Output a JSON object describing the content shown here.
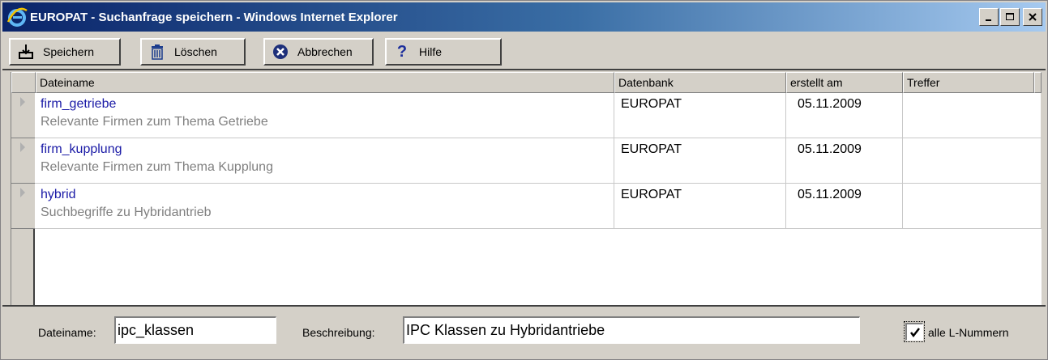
{
  "window": {
    "title": "EUROPAT - Suchanfrage speichern - Windows Internet Explorer",
    "controls": [
      "minimize",
      "maximize",
      "close"
    ]
  },
  "toolbar": {
    "save_label": "Speichern",
    "delete_label": "Löschen",
    "cancel_label": "Abbrechen",
    "help_label": "Hilfe",
    "icons": [
      "save-icon",
      "trash-icon",
      "cancel-icon",
      "help-icon"
    ]
  },
  "table": {
    "headers": [
      "Dateiname",
      "Datenbank",
      "erstellt am",
      "Treffer"
    ],
    "rows": [
      {
        "name": "firm_getriebe",
        "description": "Relevante Firmen zum Thema Getriebe",
        "database": "EUROPAT",
        "date": "05.11.2009",
        "hits": ""
      },
      {
        "name": "firm_kupplung",
        "description": "Relevante Firmen zum Thema Kupplung",
        "database": "EUROPAT",
        "date": "05.11.2009",
        "hits": ""
      },
      {
        "name": "hybrid",
        "description": "Suchbegriffe zu Hybridantrieb",
        "database": "EUROPAT",
        "date": "05.11.2009",
        "hits": ""
      }
    ]
  },
  "form": {
    "filename_label": "Dateiname:",
    "filename_value": "ipc_klassen",
    "description_label": "Beschreibung:",
    "description_value": "IPC Klassen zu Hybridantriebe",
    "checkbox_label": "alle L-Nummern",
    "checkbox_checked": true
  },
  "colors": {
    "title_start": "#0a246a",
    "title_end": "#a6caf0",
    "filename_link": "#1a1aa6",
    "description_gray": "#808080",
    "window_face": "#d4d0c8"
  }
}
